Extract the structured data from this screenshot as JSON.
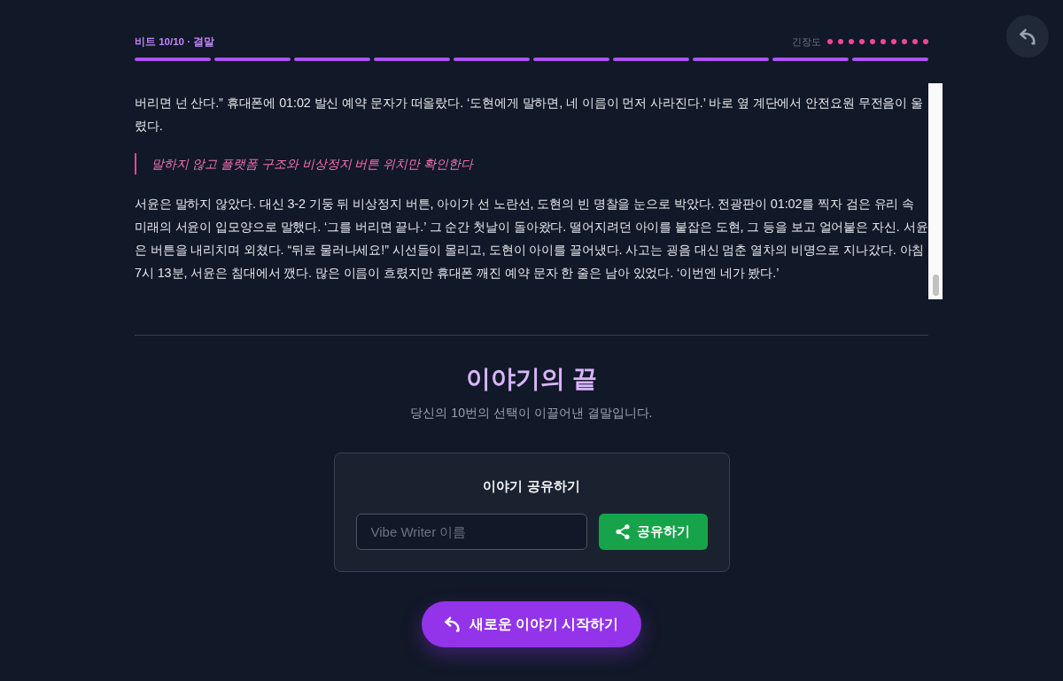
{
  "header": {
    "beat_label": "비트 10/10 · 결말",
    "tension": {
      "label": "긴장도",
      "dots": [
        {
          "filled": true
        },
        {
          "filled": true
        },
        {
          "filled": true
        },
        {
          "filled": true
        },
        {
          "filled": true
        },
        {
          "filled": true
        },
        {
          "filled": true
        },
        {
          "filled": true
        },
        {
          "filled": true
        },
        {
          "filled": true
        }
      ]
    },
    "progress": [
      {
        "done": true
      },
      {
        "done": true
      },
      {
        "done": true
      },
      {
        "done": true
      },
      {
        "done": true
      },
      {
        "done": true
      },
      {
        "done": true
      },
      {
        "done": true
      },
      {
        "done": true
      },
      {
        "done": true
      }
    ]
  },
  "story": {
    "paragraphs": [
      {
        "kind": "narration",
        "text": "버리면 넌 산다.” 휴대폰에 01:02 발신 예약 문자가 떠올랐다. ‘도현에게 말하면, 네 이름이 먼저 사라진다.’ 바로 옆 계단에서 안전요원 무전음이 울렸다."
      },
      {
        "kind": "choice",
        "text": "말하지 않고 플랫폼 구조와 비상정지 버튼 위치만 확인한다"
      },
      {
        "kind": "narration",
        "text": "서윤은 말하지 않았다. 대신 3-2 기둥 뒤 비상정지 버튼, 아이가 선 노란선, 도현의 빈 명찰을 눈으로 박았다. 전광판이 01:02를 찍자 검은 유리 속 미래의 서윤이 입모양으로 말했다. ‘그를 버리면 끝나.’ 그 순간 첫날이 돌아왔다. 떨어지려던 아이를 붙잡은 도현, 그 등을 보고 얼어붙은 자신. 서윤은 버튼을 내리치며 외쳤다. “뒤로 물러나세요!” 시선들이 몰리고, 도현이 아이를 끌어냈다. 사고는 굉음 대신 멈춘 열차의 비명으로 지나갔다. 아침 7시 13분, 서윤은 침대에서 깼다. 많은 이름이 흐렸지만 휴대폰 깨진 예약 문자 한 줄은 남아 있었다. ‘이번엔 네가 봤다.’"
      }
    ]
  },
  "ending": {
    "title": "이야기의 끝",
    "subtitle": "당신의 10번의 선택이 이끌어낸 결말입니다."
  },
  "share": {
    "title": "이야기 공유하기",
    "name_field": {
      "placeholder": "Vibe Writer 이름"
    },
    "button": "공유하기"
  },
  "restart_button": "새로운 이야기 시작하기"
}
